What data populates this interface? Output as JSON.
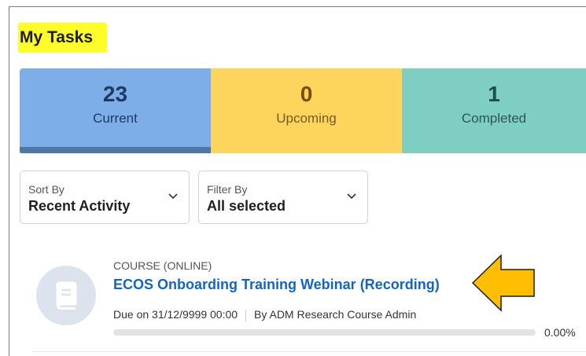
{
  "page_title": "My Tasks",
  "tabs": [
    {
      "count": "23",
      "label": "Current"
    },
    {
      "count": "0",
      "label": "Upcoming"
    },
    {
      "count": "1",
      "label": "Completed"
    }
  ],
  "sort": {
    "label": "Sort By",
    "value": "Recent Activity"
  },
  "filter": {
    "label": "Filter By",
    "value": "All selected"
  },
  "task": {
    "type": "COURSE (ONLINE)",
    "title": "ECOS Onboarding Training Webinar (Recording)",
    "due": "Due on 31/12/9999 00:00",
    "author": "By ADM Research Course Admin",
    "progress_value": 0,
    "progress_text": "0.00%"
  },
  "colors": {
    "highlight": "#fdfd2a",
    "tab_current": "#7eaee8",
    "tab_upcoming": "#fed55c",
    "tab_completed": "#7fcec4",
    "link": "#1565c0",
    "arrow": "#ffbf00"
  },
  "icons": {
    "chevron": "chevron-down-icon",
    "course": "book-icon",
    "annotation": "arrow-left-icon"
  }
}
